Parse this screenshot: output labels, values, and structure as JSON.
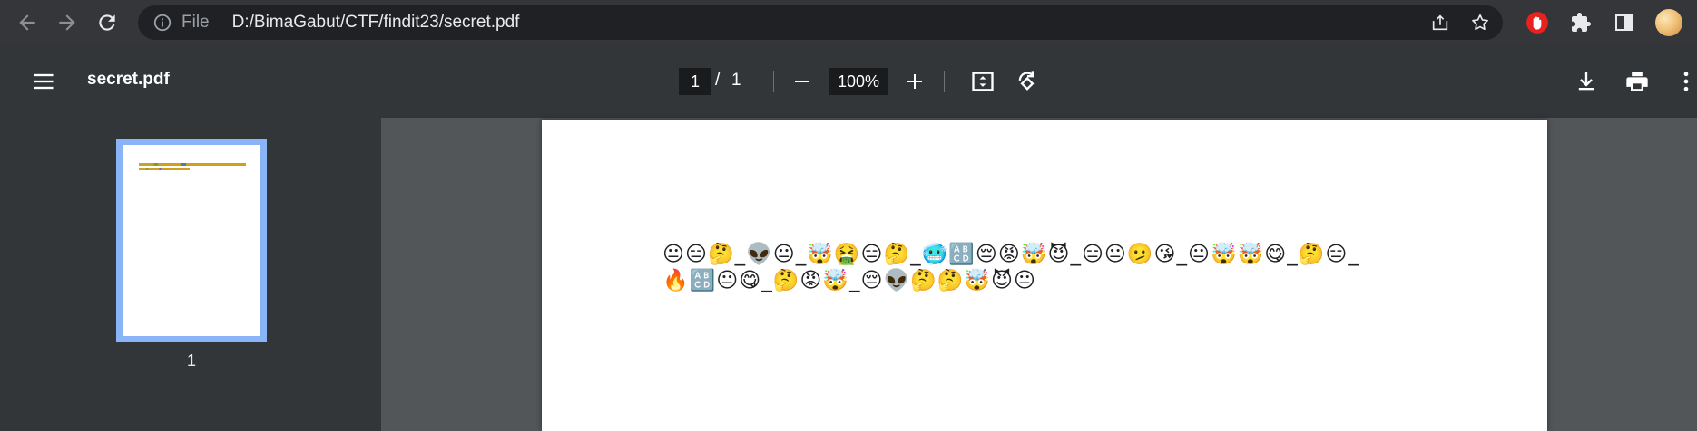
{
  "browser": {
    "scheme_label": "File",
    "url": "D:/BimaGabut/CTF/findit23/secret.pdf",
    "icons": [
      "back-arrow-icon",
      "forward-arrow-icon",
      "reload-icon",
      "info-icon",
      "share-icon",
      "bookmark-star-icon",
      "extension-shield-icon",
      "puzzle-icon",
      "side-panel-icon",
      "avatar"
    ],
    "extension_color": "#e8231f"
  },
  "pdf_toolbar": {
    "title": "secret.pdf",
    "page_current": "1",
    "page_separator": "/",
    "page_total": "1",
    "zoom": "100%"
  },
  "sidebar": {
    "thumbnails": [
      {
        "page_label": "1"
      }
    ],
    "accent_color": "#8ab4f8"
  },
  "document": {
    "line_1": "😐😑🤔_👽😐_🤯🤮😑🤔_🥶🔠😔😡🤯😈_😑😐🫤😘_😐🤯🤯😋_🤔😑_",
    "line_2": "🔥🔠😐😋_🤔😡🤯_😔👽🤔🤔🤯😈😐"
  }
}
